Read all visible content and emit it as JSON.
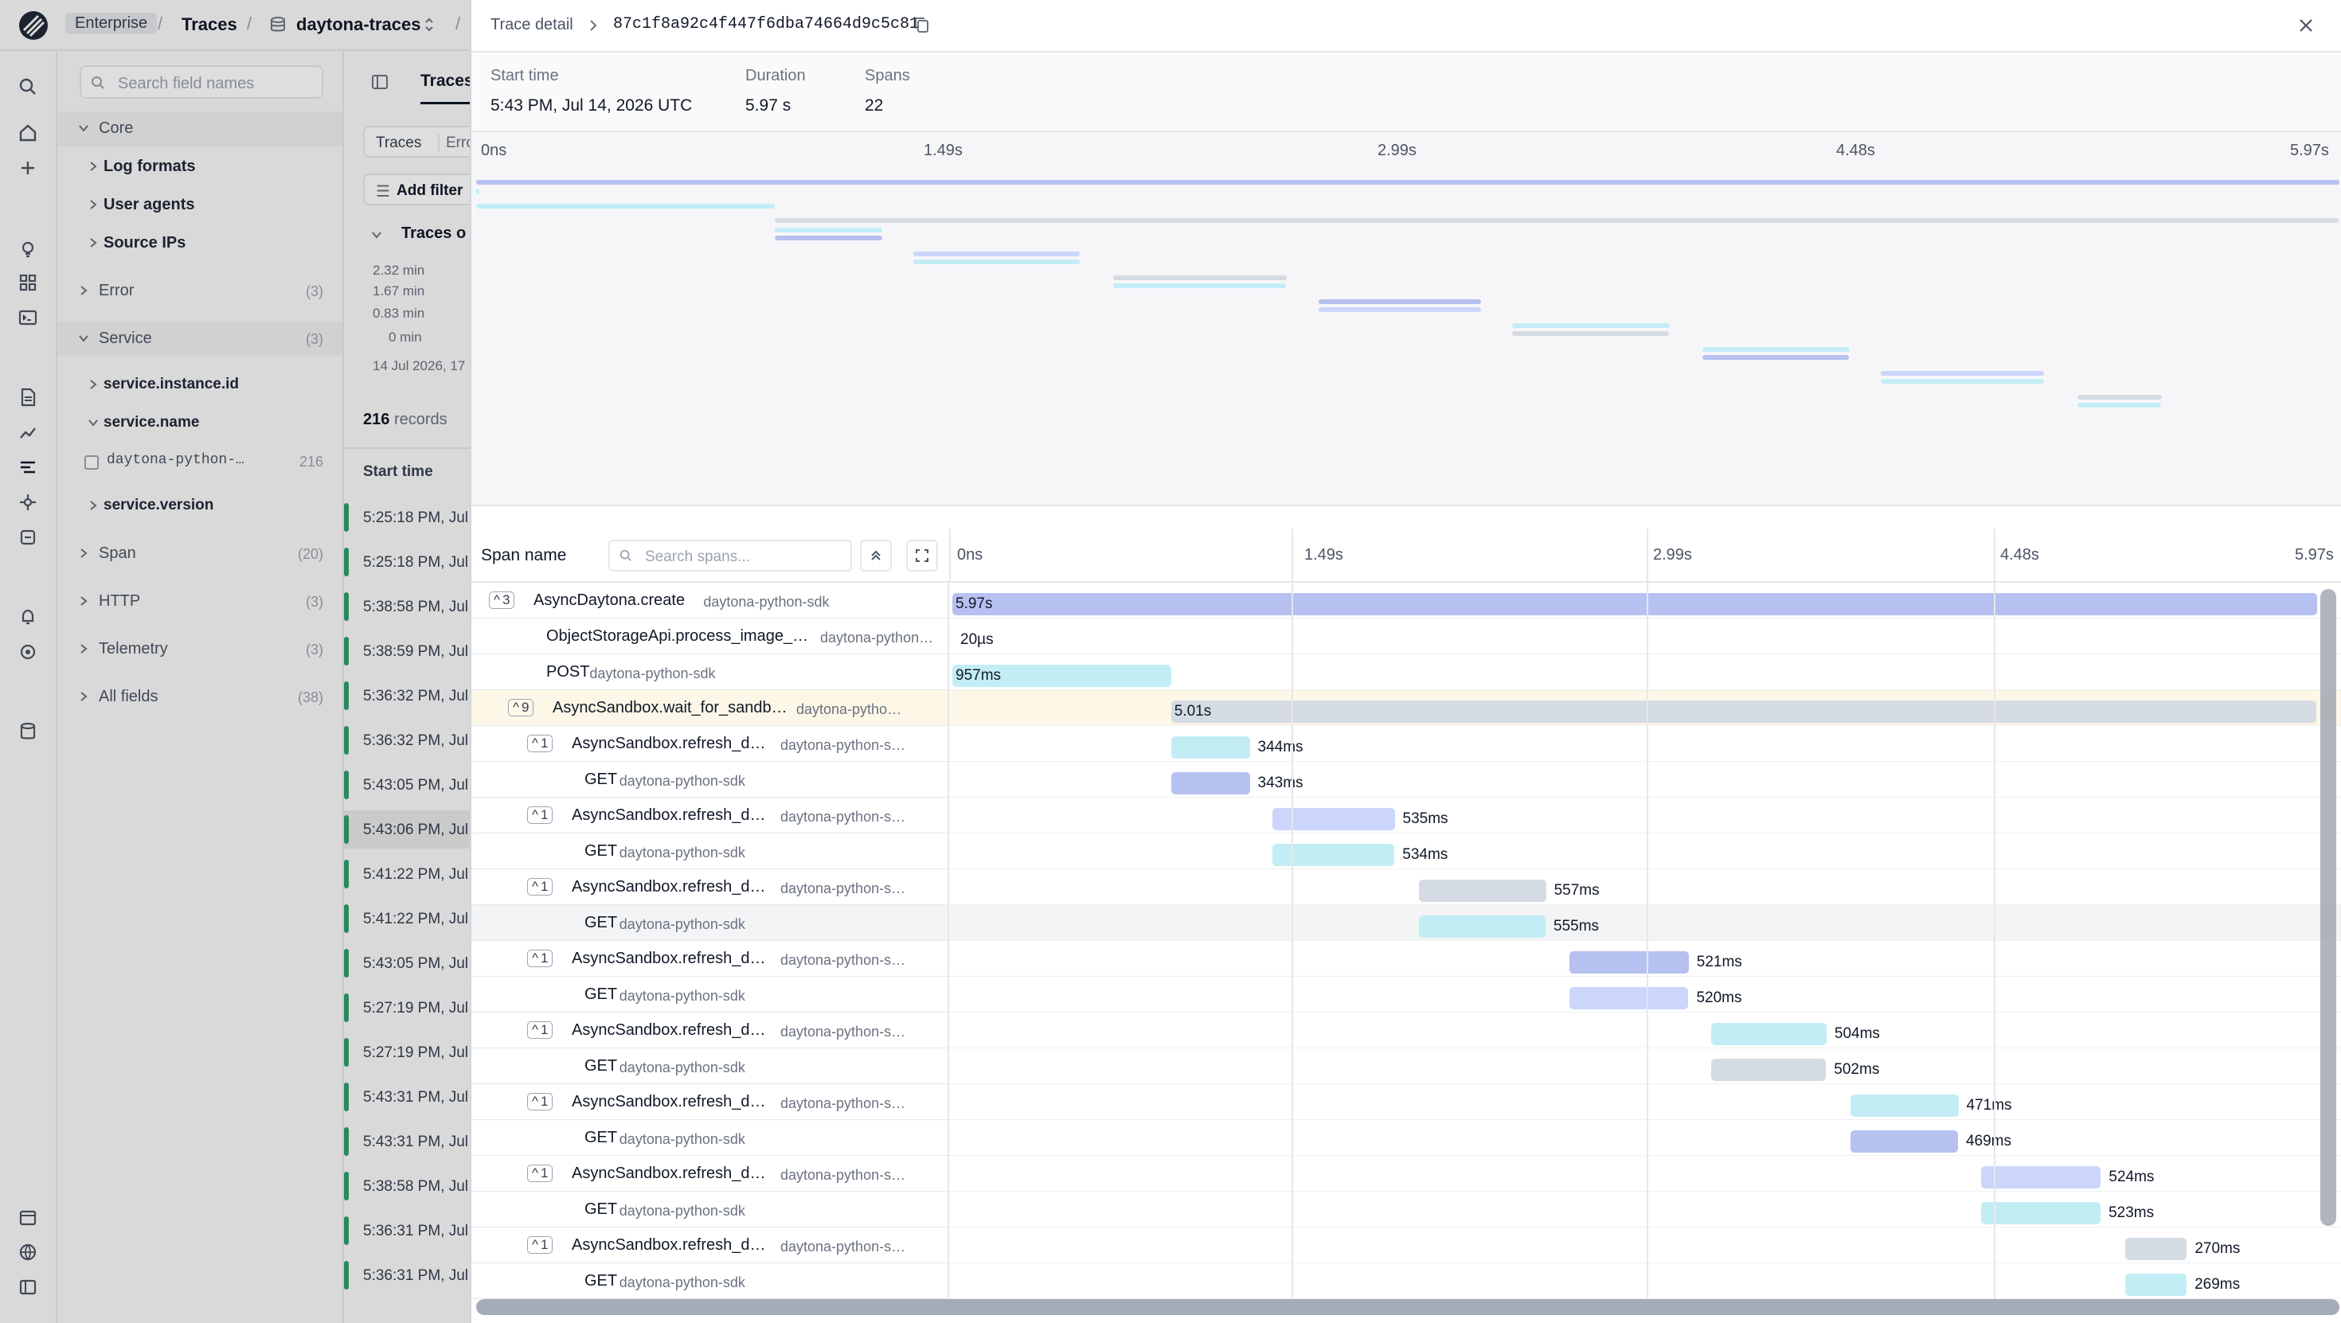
{
  "topbar": {
    "enterprise": "Enterprise",
    "traces": "Traces",
    "dataset": "daytona-traces"
  },
  "fields": {
    "search_placeholder": "Search field names",
    "core": "Core",
    "log_formats": "Log formats",
    "user_agents": "User agents",
    "source_ips": "Source IPs",
    "error": "Error",
    "error_count": "(3)",
    "service": "Service",
    "service_count": "(3)",
    "service_instance_id": "service.instance.id",
    "service_name": "service.name",
    "service_name_value": "daytona-python-…",
    "service_name_value_count": "216",
    "service_version": "service.version",
    "span": "Span",
    "span_count": "(20)",
    "http": "HTTP",
    "http_count": "(3)",
    "telemetry": "Telemetry",
    "telemetry_count": "(3)",
    "all_fields": "All fields",
    "all_fields_count": "(38)"
  },
  "list": {
    "tab_traces": "Traces",
    "tab_traces_btn": "Traces",
    "tab_errors": "Erro",
    "add_filter": "Add filter",
    "traces_over": "Traces o",
    "y_ticks": [
      "2.32 min",
      "1.67 min",
      "0.83 min",
      "0 min"
    ],
    "x_tick": "14 Jul 2026, 17",
    "records_count": "216",
    "records_label": "records",
    "col_start": "Start time",
    "rows": [
      "5:25:18 PM, Jul",
      "5:25:18 PM, Jul",
      "5:38:58 PM, Jul",
      "5:38:59 PM, Jul",
      "5:36:32 PM, Jul",
      "5:36:32 PM, Jul",
      "5:43:05 PM, Jul",
      "5:43:06 PM, Jul",
      "5:41:22 PM, Jul",
      "5:41:22 PM, Jul",
      "5:43:05 PM, Jul",
      "5:27:19 PM, Jul",
      "5:27:19 PM, Jul",
      "5:43:31 PM, Jul",
      "5:43:31 PM, Jul",
      "5:38:58 PM, Jul",
      "5:36:31 PM, Jul",
      "5:36:31 PM, Jul"
    ]
  },
  "trace": {
    "title": "Trace detail",
    "id": "87c1f8a92c4f447f6dba74664d9c5c81",
    "start_label": "Start time",
    "start_value": "5:43 PM, Jul 14, 2026 UTC",
    "duration_label": "Duration",
    "duration_value": "5.97 s",
    "spans_label": "Spans",
    "spans_value": "22",
    "overview_ticks": [
      "0ns",
      "1.49s",
      "2.99s",
      "4.48s",
      "5.97s"
    ],
    "span_name_label": "Span name",
    "search_spans_placeholder": "Search spans...",
    "wf_ticks": [
      "0ns",
      "1.49s",
      "2.99s",
      "4.48s",
      "5.97s"
    ],
    "total_s": 5.97
  },
  "colors": {
    "blue": "#b6c1f1",
    "cyan": "#c3edf5",
    "slate": "#d4dbe3",
    "lavender": "#ccd5fb",
    "accent": "#2f9e6b"
  },
  "spans": [
    {
      "name": "AsyncDaytona.create",
      "service": "daytona-python-sdk",
      "children": "3",
      "depth": 0,
      "start_s": 0,
      "dur_s": 5.97,
      "dur": "5.97s",
      "color": "blue",
      "inside": true
    },
    {
      "name": "ObjectStorageApi.process_image_…",
      "service": "daytona-python…",
      "depth": 1,
      "start_s": 0,
      "dur_s": 2e-05,
      "dur": "20µs",
      "color": "cyan"
    },
    {
      "name": "POST",
      "service": "daytona-python-sdk",
      "depth": 1,
      "start_s": 0,
      "dur_s": 0.957,
      "dur": "957ms",
      "color": "cyan",
      "inside": true
    },
    {
      "name": "AsyncSandbox.wait_for_sandb…",
      "service": "daytona-pytho…",
      "children": "9",
      "depth": 1,
      "start_s": 0.957,
      "dur_s": 5.01,
      "dur": "5.01s",
      "color": "slate",
      "inside": true,
      "selected": true
    },
    {
      "name": "AsyncSandbox.refresh_d…",
      "service": "daytona-python-s…",
      "children": "1",
      "depth": 2,
      "start_s": 0.957,
      "dur_s": 0.344,
      "dur": "344ms",
      "color": "cyan"
    },
    {
      "name": "GET",
      "service": "daytona-python-sdk",
      "depth": 3,
      "start_s": 0.958,
      "dur_s": 0.343,
      "dur": "343ms",
      "color": "blue"
    },
    {
      "name": "AsyncSandbox.refresh_d…",
      "service": "daytona-python-s…",
      "children": "1",
      "depth": 2,
      "start_s": 1.4,
      "dur_s": 0.535,
      "dur": "535ms",
      "color": "lavender"
    },
    {
      "name": "GET",
      "service": "daytona-python-sdk",
      "depth": 3,
      "start_s": 1.4,
      "dur_s": 0.534,
      "dur": "534ms",
      "color": "cyan"
    },
    {
      "name": "AsyncSandbox.refresh_d…",
      "service": "daytona-python-s…",
      "children": "1",
      "depth": 2,
      "start_s": 2.04,
      "dur_s": 0.557,
      "dur": "557ms",
      "color": "slate"
    },
    {
      "name": "GET",
      "service": "daytona-python-sdk",
      "depth": 3,
      "start_s": 2.04,
      "dur_s": 0.555,
      "dur": "555ms",
      "color": "cyan",
      "hover": true
    },
    {
      "name": "AsyncSandbox.refresh_d…",
      "service": "daytona-python-s…",
      "children": "1",
      "depth": 2,
      "start_s": 2.7,
      "dur_s": 0.521,
      "dur": "521ms",
      "color": "blue"
    },
    {
      "name": "GET",
      "service": "daytona-python-sdk",
      "depth": 3,
      "start_s": 2.7,
      "dur_s": 0.52,
      "dur": "520ms",
      "color": "lavender"
    },
    {
      "name": "AsyncSandbox.refresh_d…",
      "service": "daytona-python-s…",
      "children": "1",
      "depth": 2,
      "start_s": 3.32,
      "dur_s": 0.504,
      "dur": "504ms",
      "color": "cyan"
    },
    {
      "name": "GET",
      "service": "daytona-python-sdk",
      "depth": 3,
      "start_s": 3.32,
      "dur_s": 0.502,
      "dur": "502ms",
      "color": "slate"
    },
    {
      "name": "AsyncSandbox.refresh_d…",
      "service": "daytona-python-s…",
      "children": "1",
      "depth": 2,
      "start_s": 3.93,
      "dur_s": 0.471,
      "dur": "471ms",
      "color": "cyan"
    },
    {
      "name": "GET",
      "service": "daytona-python-sdk",
      "depth": 3,
      "start_s": 3.93,
      "dur_s": 0.469,
      "dur": "469ms",
      "color": "blue"
    },
    {
      "name": "AsyncSandbox.refresh_d…",
      "service": "daytona-python-s…",
      "children": "1",
      "depth": 2,
      "start_s": 4.5,
      "dur_s": 0.524,
      "dur": "524ms",
      "color": "lavender"
    },
    {
      "name": "GET",
      "service": "daytona-python-sdk",
      "depth": 3,
      "start_s": 4.5,
      "dur_s": 0.523,
      "dur": "523ms",
      "color": "cyan"
    },
    {
      "name": "AsyncSandbox.refresh_d…",
      "service": "daytona-python-s…",
      "children": "1",
      "depth": 2,
      "start_s": 5.13,
      "dur_s": 0.27,
      "dur": "270ms",
      "color": "slate"
    },
    {
      "name": "GET",
      "service": "daytona-python-sdk",
      "depth": 3,
      "start_s": 5.13,
      "dur_s": 0.269,
      "dur": "269ms",
      "color": "cyan"
    }
  ]
}
